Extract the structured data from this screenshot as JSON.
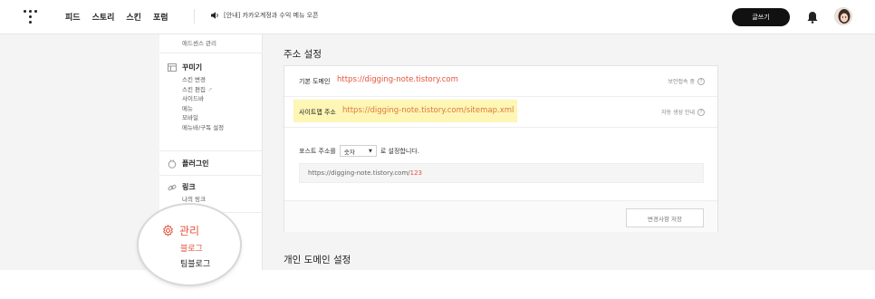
{
  "nav": {
    "items": [
      "피드",
      "스토리",
      "스킨",
      "포럼"
    ],
    "notice": "[안내] 카카오계정과 수익 메뉴 오픈",
    "write_label": "글쓰기"
  },
  "sidebar": {
    "top_item": "애드센스 관리",
    "decorate": {
      "title": "꾸미기",
      "items": [
        "스킨 변경",
        "스킨 편집",
        "사이드바",
        "메뉴",
        "모바일",
        "메뉴바/구독 설정"
      ]
    },
    "plugin": {
      "title": "플러그인"
    },
    "link": {
      "title": "링크",
      "items": [
        "나의 링크"
      ]
    }
  },
  "main": {
    "title": "주소 설정",
    "default_domain_label": "기본 도메인",
    "default_domain_url": "https://digging-note.tistory.com",
    "secure_hint": "보안접속 중",
    "sitemap_label": "사이트맵 주소",
    "sitemap_url": "https://digging-note.tistory.com/sitemap.xml",
    "sitemap_hint": "자동 생성 안내",
    "post_format_prefix": "포스트 주소를",
    "post_format_value": "숫자",
    "post_format_suffix": "로 설정합니다.",
    "preview_base": "https://digging-note.tistory.com/",
    "preview_num": "123",
    "save_label": "변경사항 저장",
    "section2_title": "개인 도메인 설정"
  },
  "magnifier": {
    "title": "관리",
    "items": [
      "블로그",
      "팀블로그"
    ]
  },
  "colors": {
    "accent": "#e5533c",
    "highlight": "#fdf6b5"
  }
}
